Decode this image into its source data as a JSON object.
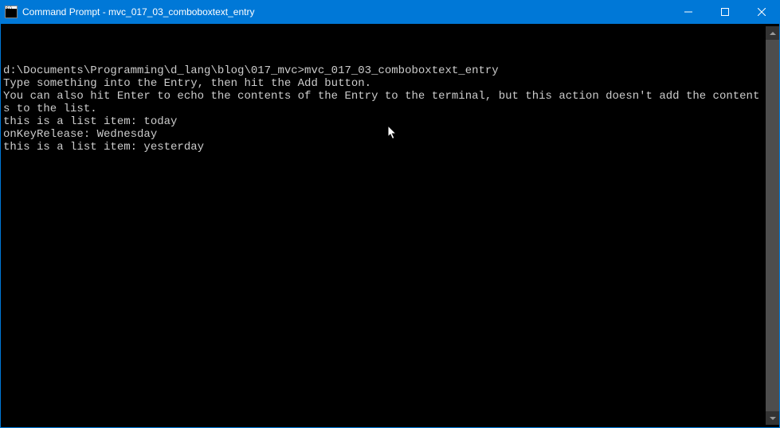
{
  "window": {
    "title": "Command Prompt - mvc_017_03_comboboxtext_entry",
    "icon_name": "command-prompt-icon"
  },
  "titlebar_controls": {
    "minimize": "minimize-icon",
    "maximize": "maximize-icon",
    "close": "close-icon"
  },
  "terminal": {
    "lines": [
      "",
      "d:\\Documents\\Programming\\d_lang\\blog\\017_mvc>mvc_017_03_comboboxtext_entry",
      "Type something into the Entry, then hit the Add button.",
      "You can also hit Enter to echo the contents of the Entry to the terminal, but this action doesn't add the contents to the list.",
      "this is a list item: today",
      "onKeyRelease: Wednesday",
      "this is a list item: yesterday"
    ]
  }
}
